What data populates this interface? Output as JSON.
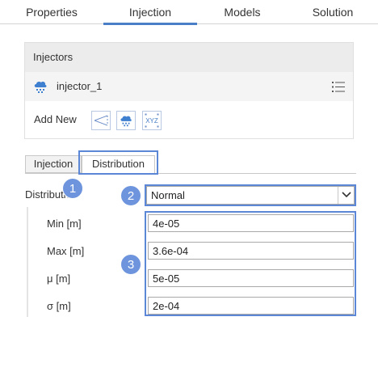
{
  "top_tabs": [
    "Properties",
    "Injection",
    "Models",
    "Solution"
  ],
  "active_top_tab": "Injection",
  "injectors": {
    "header": "Injectors",
    "items": [
      {
        "name": "injector_1",
        "icon": "rain-cloud-icon"
      }
    ],
    "add_new_label": "Add New",
    "add_buttons": [
      {
        "icon": "cone-injector-icon"
      },
      {
        "icon": "rain-cloud-icon"
      },
      {
        "icon": "xyz-points-icon",
        "text": "XYZ"
      }
    ]
  },
  "sub_tabs": [
    "Injection",
    "Distribution"
  ],
  "active_sub_tab": "Distribution",
  "distribution": {
    "label": "Distribution",
    "selected": "Normal"
  },
  "params": [
    {
      "label": "Min [m]",
      "value": "4e-05"
    },
    {
      "label": "Max [m]",
      "value": "3.6e-04"
    },
    {
      "label": "μ [m]",
      "value": "5e-05"
    },
    {
      "label": "σ [m]",
      "value": "2e-04"
    }
  ],
  "badges": [
    "1",
    "2",
    "3"
  ],
  "colors": {
    "accent": "#4a7fc8",
    "highlight": "#5b87d6",
    "badge": "#6d94dc"
  }
}
